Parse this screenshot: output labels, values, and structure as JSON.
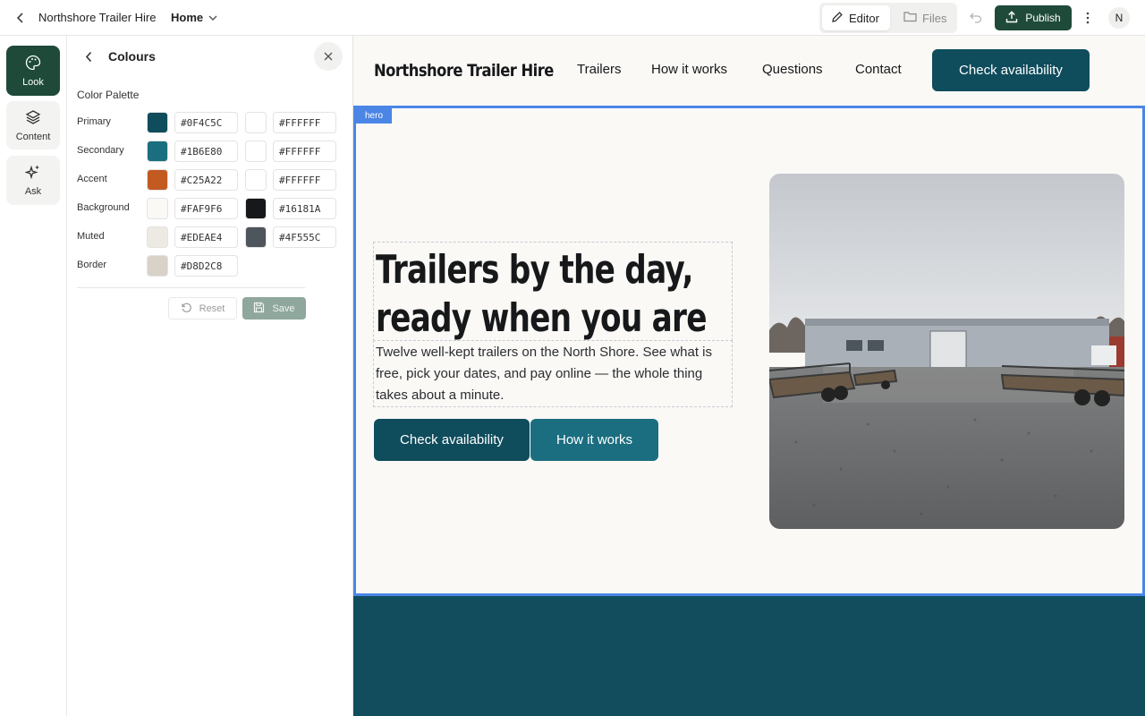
{
  "topbar": {
    "site_name": "Northshore Trailer Hire",
    "page_selector": "Home",
    "editor_label": "Editor",
    "files_label": "Files",
    "publish_label": "Publish",
    "avatar_initial": "N"
  },
  "rail": {
    "look": "Look",
    "content": "Content",
    "ask": "Ask"
  },
  "panel": {
    "title": "Colours",
    "section": "Color Palette",
    "rows": [
      {
        "label": "Primary",
        "color1": "#0F4C5C",
        "color2": "#FFFFFF"
      },
      {
        "label": "Secondary",
        "color1": "#1B6E80",
        "color2": "#FFFFFF"
      },
      {
        "label": "Accent",
        "color1": "#C25A22",
        "color2": "#FFFFFF"
      },
      {
        "label": "Background",
        "color1": "#FAF9F6",
        "color2": "#16181A"
      },
      {
        "label": "Muted",
        "color1": "#EDEAE4",
        "color2": "#4F555C"
      },
      {
        "label": "Border",
        "color1": "#D8D2C8"
      }
    ],
    "reset_label": "Reset",
    "save_label": "Save"
  },
  "site": {
    "brand": "Northshore Trailer Hire",
    "nav": [
      "Trailers",
      "How it works",
      "Questions",
      "Contact"
    ],
    "nav_cta": "Check availability",
    "hero_tag": "hero",
    "headline": "Trailers by the day, ready when you are",
    "subtext": "Twelve well-kept trailers on the North Shore. See what is free, pick your dates, and pay online — the whole thing takes about a minute.",
    "primary_button": "Check availability",
    "secondary_button": "How it works"
  }
}
